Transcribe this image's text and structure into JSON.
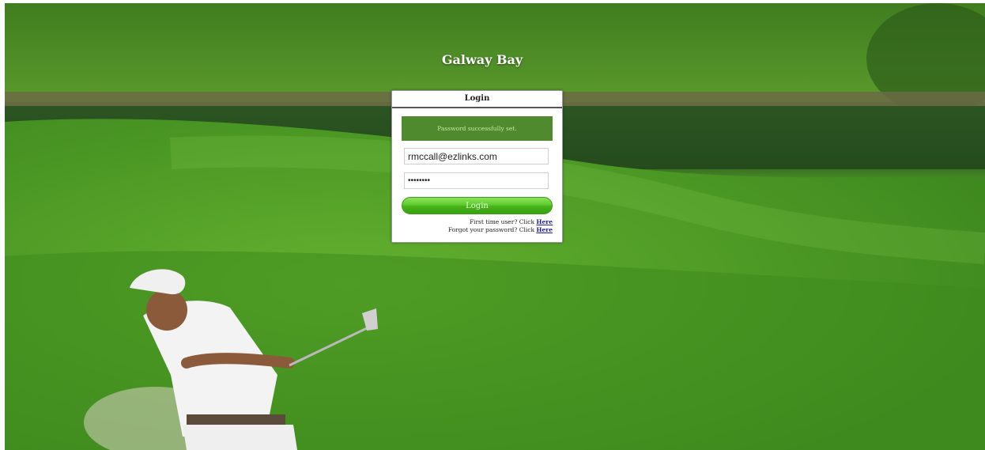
{
  "brand": {
    "title": "Galway Bay"
  },
  "login": {
    "header": "Login",
    "status_message": "Password successfully set.",
    "email_value": "rmccall@ezlinks.com",
    "password_value": "••••••••",
    "login_button": "Login",
    "first_time_text": "First time user? Click",
    "forgot_text": "Forgot your password? Click",
    "here_link": "Here"
  },
  "colors": {
    "success_bg": "#4f8a2e",
    "button_green": "#46b118",
    "link": "#1a1aa6"
  }
}
